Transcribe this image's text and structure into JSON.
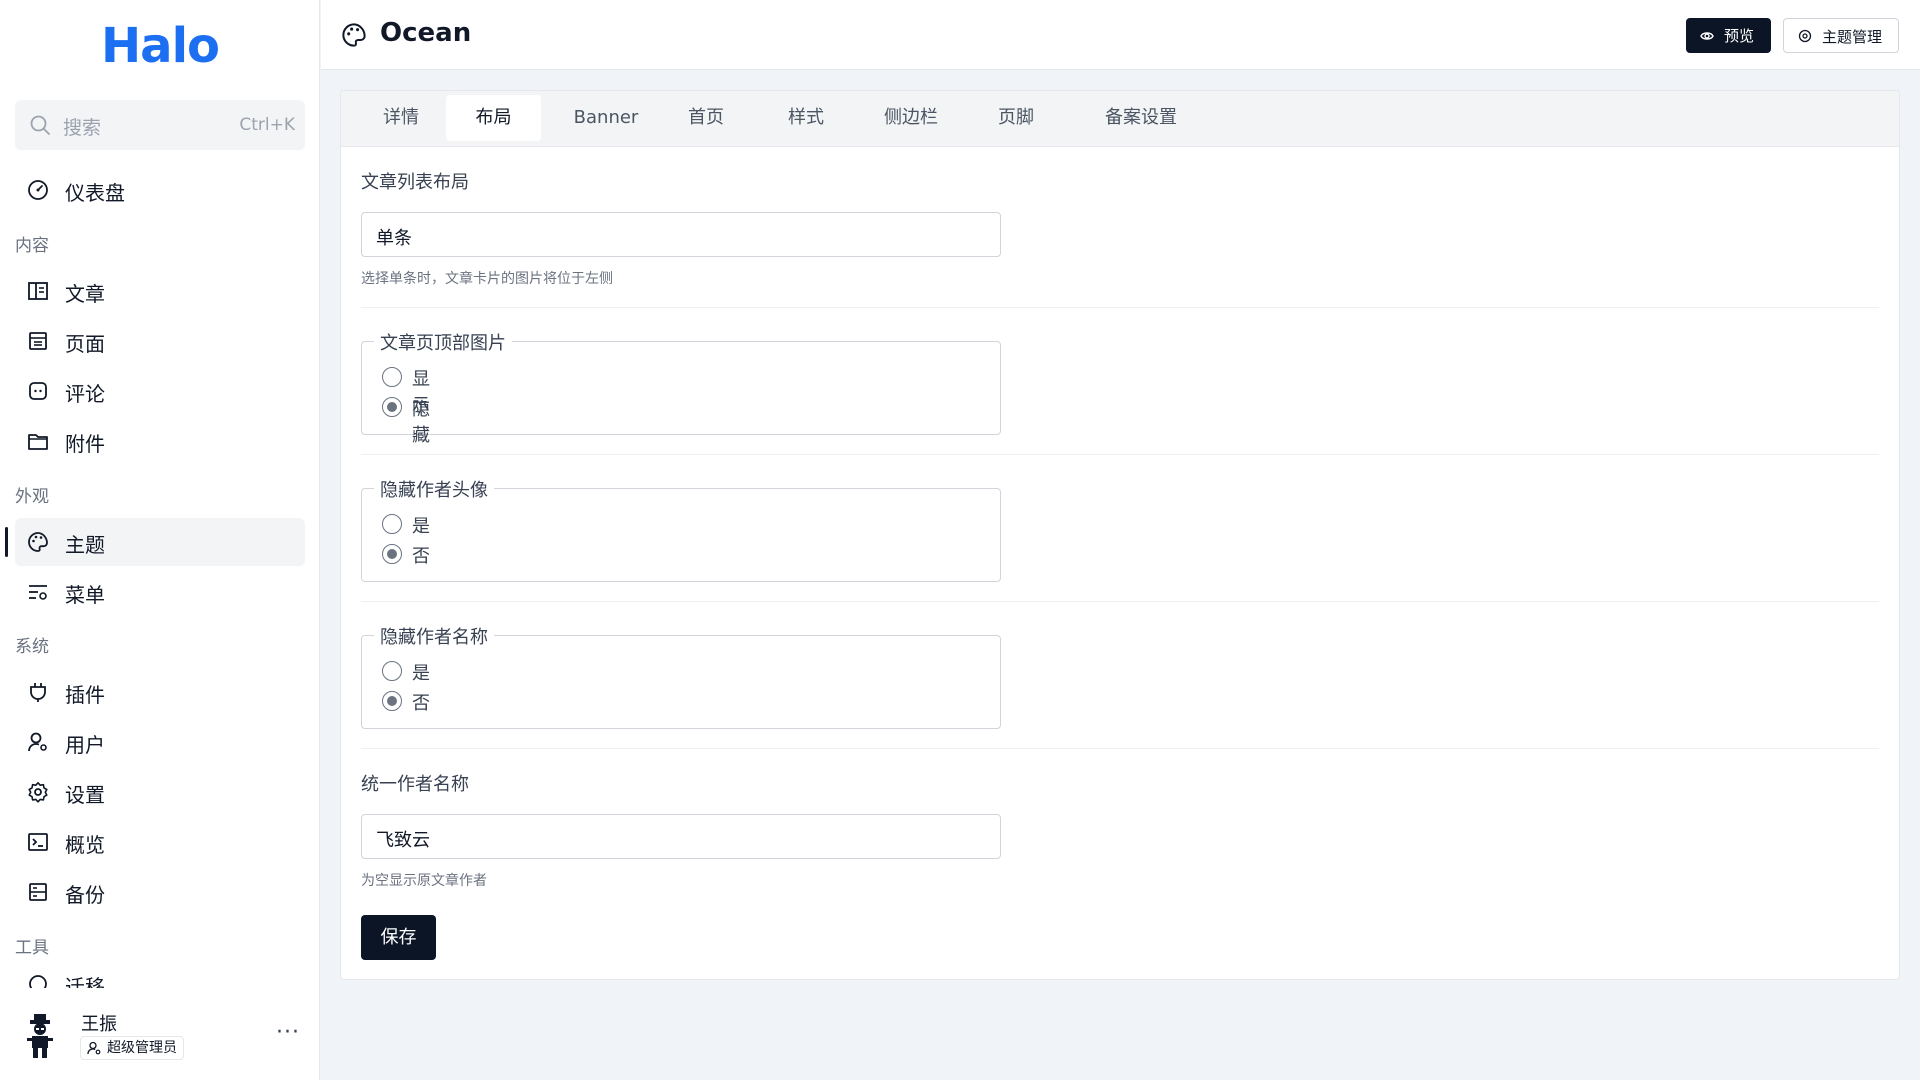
{
  "app": {
    "logo": "Halo"
  },
  "sidebar": {
    "search": {
      "placeholder": "搜索",
      "shortcut": "Ctrl+K"
    },
    "dashboard": "仪表盘",
    "groups": {
      "content": "内容",
      "appearance": "外观",
      "system": "系统",
      "tools": "工具"
    },
    "items": {
      "posts": "文章",
      "pages": "页面",
      "comments": "评论",
      "attachments": "附件",
      "themes": "主题",
      "menus": "菜单",
      "plugins": "插件",
      "users": "用户",
      "settings": "设置",
      "overview": "概览",
      "backup": "备份",
      "migration": "迁移"
    },
    "user": {
      "name": "王振",
      "role": "超级管理员",
      "more": "···"
    }
  },
  "header": {
    "title": "Ocean",
    "preview_label": "预览",
    "theme_manage_label": "主题管理"
  },
  "tabs": [
    "详情",
    "布局",
    "Banner",
    "首页",
    "样式",
    "侧边栏",
    "页脚",
    "备案设置"
  ],
  "active_tab": "布局",
  "form": {
    "post_list_layout": {
      "label": "文章列表布局",
      "value": "单条",
      "help": "选择单条时，文章卡片的图片将位于左侧"
    },
    "post_top_image": {
      "legend": "文章页顶部图片",
      "options": [
        "显示",
        "隐藏"
      ],
      "selected": "隐藏"
    },
    "hide_author_avatar": {
      "legend": "隐藏作者头像",
      "options": [
        "是",
        "否"
      ],
      "selected": "否"
    },
    "hide_author_name": {
      "legend": "隐藏作者名称",
      "options": [
        "是",
        "否"
      ],
      "selected": "否"
    },
    "unified_author_name": {
      "label": "统一作者名称",
      "value": "飞致云",
      "help": "为空显示原文章作者"
    },
    "save_label": "保存"
  },
  "colors": {
    "brand": "#1d6ff2",
    "primary_button": "#0b1526",
    "page_bg": "#f0f4f8"
  }
}
